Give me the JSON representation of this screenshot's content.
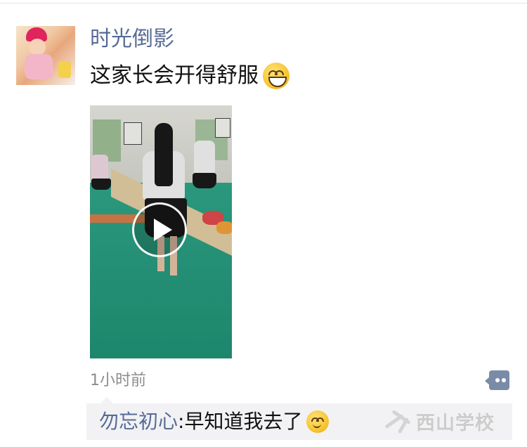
{
  "post": {
    "nickname": "时光倒影",
    "text": "这家长会开得舒服",
    "text_emoji": "grinning-face-emoji",
    "media": {
      "type": "video",
      "icon": "play-icon"
    },
    "timestamp": "1小时前",
    "comment_icon": "comment-icon"
  },
  "comments": [
    {
      "author": "勿忘初心",
      "separator": ": ",
      "text": "早知道我去了",
      "emoji": "smiling-face-emoji"
    }
  ],
  "watermark": {
    "text": "西山学校",
    "icon": "school-logo-icon"
  },
  "colors": {
    "nickname": "#576b95",
    "text": "#111111",
    "timestamp": "#8c8c8c",
    "comment_bg": "#f2f2f4",
    "comment_button": "#7a8ba8"
  }
}
